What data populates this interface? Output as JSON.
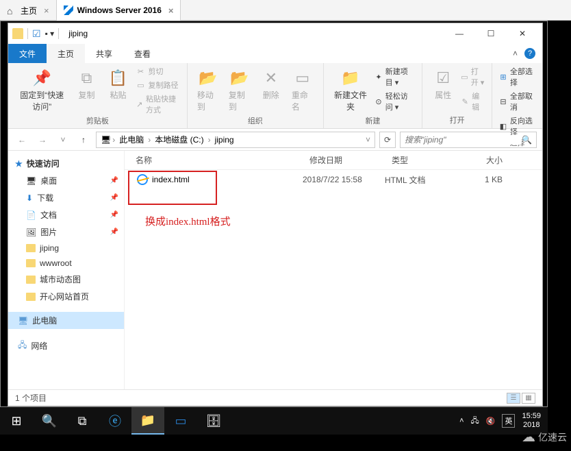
{
  "browser": {
    "tabs": [
      {
        "label": "主页"
      },
      {
        "label": "Windows Server 2016"
      }
    ]
  },
  "titlebar": {
    "title": "jiping",
    "sep": "|"
  },
  "ribbonTabs": {
    "file": "文件",
    "home": "主页",
    "share": "共享",
    "view": "查看"
  },
  "ribbon": {
    "pin": "固定到“快速访问”",
    "copy": "复制",
    "paste": "粘贴",
    "cut": "剪切",
    "copyPath": "复制路径",
    "pasteShortcut": "粘贴快捷方式",
    "clipboard": "剪贴板",
    "moveTo": "移动到",
    "copyTo": "复制到",
    "delete": "删除",
    "rename": "重命名",
    "organize": "组织",
    "newFolder": "新建文件夹",
    "newItem": "新建项目 ▾",
    "easyAccess": "轻松访问 ▾",
    "newGroup": "新建",
    "properties": "属性",
    "open": "打开 ▾",
    "edit": "编辑",
    "openGroup": "打开",
    "selectAll": "全部选择",
    "selectNone": "全部取消",
    "invert": "反向选择",
    "selectGroup": "选择"
  },
  "breadcrumbs": {
    "pc": "此电脑",
    "drive": "本地磁盘 (C:)",
    "folder": "jiping",
    "sep": "›"
  },
  "search": {
    "placeholder": "搜索\"jiping\""
  },
  "columns": {
    "name": "名称",
    "date": "修改日期",
    "type": "类型",
    "size": "大小"
  },
  "nav": {
    "quick": "快速访问",
    "desktop": "桌面",
    "downloads": "下载",
    "documents": "文档",
    "pictures": "图片",
    "jiping": "jiping",
    "wwwroot": "wwwroot",
    "cityGif": "城市动态图",
    "happySite": "开心网站首页",
    "thisPC": "此电脑",
    "network": "网络"
  },
  "files": [
    {
      "name": "index.html",
      "date": "2018/7/22 15:58",
      "type": "HTML 文档",
      "size": "1 KB"
    }
  ],
  "annotation": "换成index.html格式",
  "status": {
    "count": "1 个项目"
  },
  "tray": {
    "ime": "英",
    "time": "15:59",
    "date": "2018"
  },
  "watermark": "亿速云"
}
